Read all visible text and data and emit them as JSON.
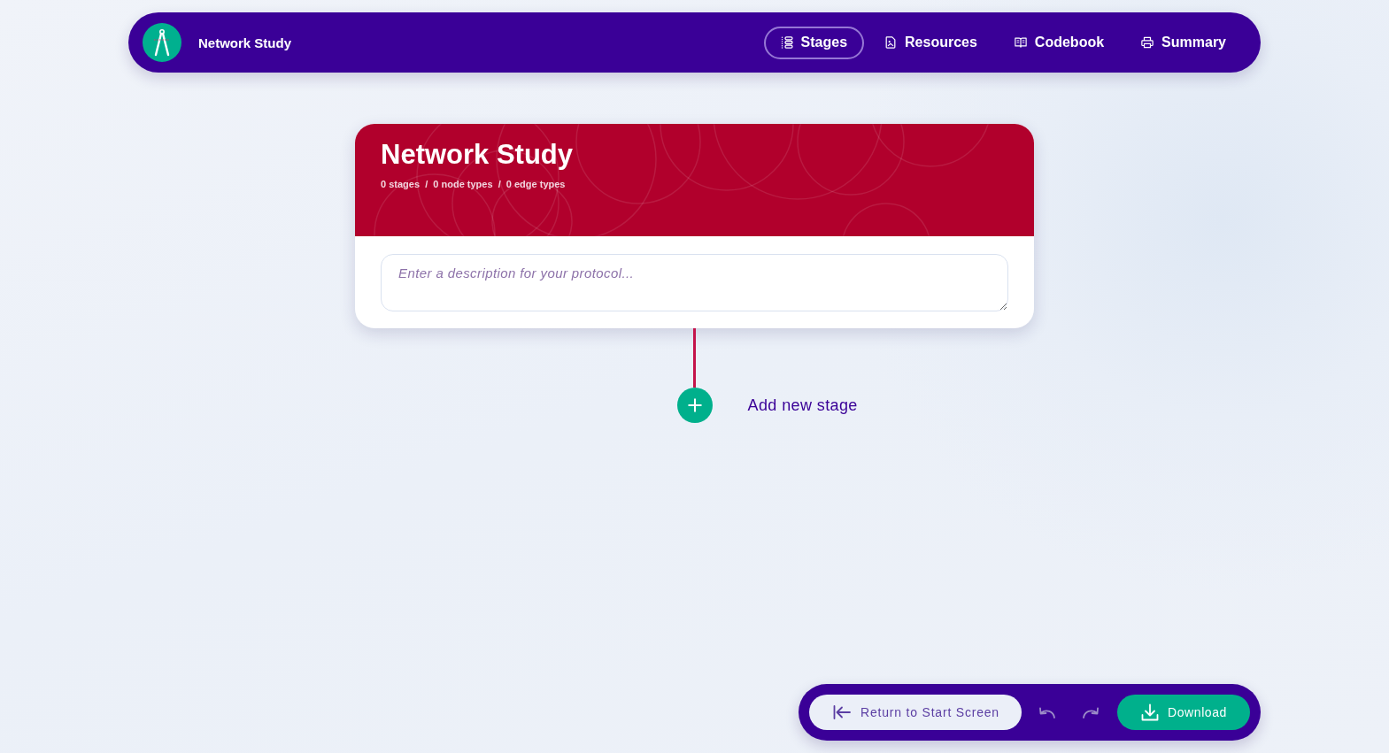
{
  "nav": {
    "title": "Network Study",
    "tabs": [
      {
        "label": "Stages",
        "selected": true
      },
      {
        "label": "Resources",
        "selected": false
      },
      {
        "label": "Codebook",
        "selected": false
      },
      {
        "label": "Summary",
        "selected": false
      }
    ]
  },
  "protocol_card": {
    "title": "Network Study",
    "summary": "0 stages  /  0 node types  /  0 edge types",
    "description": {
      "placeholder": "Enter a description for your protocol..."
    }
  },
  "add_stage": {
    "label": "Add new stage"
  },
  "bottom_bar": {
    "return_button": {
      "label": "Return to Start Screen"
    },
    "undo": {
      "disabled": true
    },
    "redo": {
      "disabled": true
    },
    "download_button": {
      "label": "Download"
    }
  }
}
